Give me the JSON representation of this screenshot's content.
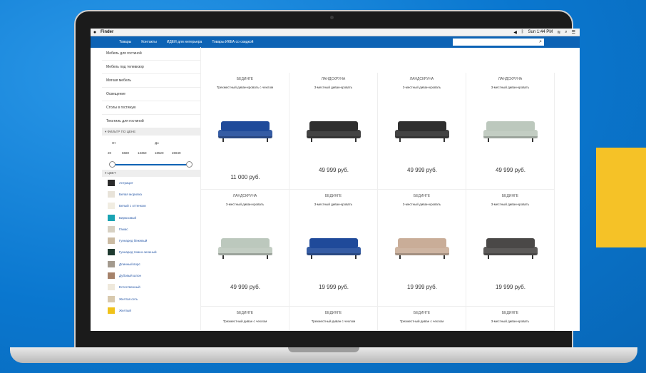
{
  "colors": {
    "nav": "#0d63b5",
    "accent": "#f5c227"
  },
  "menubar": {
    "app": "Finder",
    "status": "Sun 1:44 PM"
  },
  "nav": {
    "items": [
      "Товары",
      "Контакты",
      "ИДЕИ для интерьера",
      "Товары ИКЕА со скидкой"
    ],
    "search_placeholder": ""
  },
  "sidebar": {
    "categories": [
      "Мебель для гостиной",
      "Мебель под телевизор",
      "Мягкая мебель",
      "Освещение",
      "Столы в гостиную",
      "Текстиль для гостиной"
    ],
    "price_filter": {
      "title": "▾ ФИЛЬТР ПО ЦЕНЕ",
      "from_label": "От",
      "to_label": "До",
      "min": "20",
      "max": "26949",
      "ticks": [
        "6680",
        "13350",
        "18520"
      ]
    },
    "color_filter": {
      "title": "▾ ЦВЕТ",
      "items": [
        {
          "name": "Антрацит",
          "color": "#2b2b2b"
        },
        {
          "name": "Белая морилка",
          "color": "#e8e3d9"
        },
        {
          "name": "Белый с оттенком",
          "color": "#f1ede2"
        },
        {
          "name": "Бирюзовый",
          "color": "#1aa3b3"
        },
        {
          "name": "Гамас",
          "color": "#d7d1c3"
        },
        {
          "name": "Гуннаред бежевый",
          "color": "#cbbba3"
        },
        {
          "name": "Гуннаред темно-зеленый",
          "color": "#1f3a30"
        },
        {
          "name": "Длинный ворс",
          "color": "#a39a8e"
        },
        {
          "name": "Дубовый шпон",
          "color": "#a5826a"
        },
        {
          "name": "Естественный",
          "color": "#efe9dc"
        },
        {
          "name": "Желтая сеть",
          "color": "#d8c9ae"
        },
        {
          "name": "Желтый",
          "color": "#f0c21a"
        }
      ]
    }
  },
  "products": [
    {
      "brand": "БЕДИНГЕ",
      "desc": "Трехместный диван-кровать с чехлом",
      "price": "11 000 руб.",
      "color": "#1f4a9a"
    },
    {
      "brand": "ЛАНДСКРУНА",
      "desc": "3-местный диван-кровать",
      "price": "49 999 руб.",
      "color": "#2f2f2f"
    },
    {
      "brand": "ЛАНДСКРУНА",
      "desc": "3-местный диван-кровать",
      "price": "49 999 руб.",
      "color": "#2f2f2f"
    },
    {
      "brand": "ЛАНДСКРУНА",
      "desc": "3-местный диван-кровать",
      "price": "49 999 руб.",
      "color": "#bcc8bd"
    },
    {
      "brand": "ЛАНДСКРУНА",
      "desc": "3-местный диван-кровать",
      "price": "49 999 руб.",
      "color": "#bcc8bd"
    },
    {
      "brand": "БЕДИНГЕ",
      "desc": "3-местный диван-кровать",
      "price": "19 999 руб.",
      "color": "#1f4a9a"
    },
    {
      "brand": "БЕДИНГЕ",
      "desc": "3-местный диван-кровать",
      "price": "19 999 руб.",
      "color": "#c9ad98"
    },
    {
      "brand": "БЕДИНГЕ",
      "desc": "3-местный диван-кровать",
      "price": "19 999 руб.",
      "color": "#4a4847"
    },
    {
      "brand": "БЕДИНГЕ",
      "desc": "Трехместный диван с чехлом",
      "price": "",
      "color": ""
    },
    {
      "brand": "БЕДИНГЕ",
      "desc": "Трехместный диван с чехлом",
      "price": "",
      "color": ""
    },
    {
      "brand": "БЕДИНГЕ",
      "desc": "Трехместный диван с чехлом",
      "price": "",
      "color": ""
    },
    {
      "brand": "БЕДИНГЕ",
      "desc": "3-местный диван-кровать",
      "price": "",
      "color": ""
    }
  ]
}
